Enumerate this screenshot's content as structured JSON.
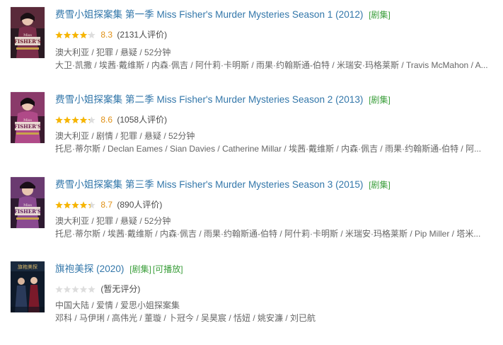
{
  "results": [
    {
      "title": "费雪小姐探案集 第一季 Miss Fisher's Murder Mysteries Season 1 (2012)",
      "tags": [
        "[剧集]"
      ],
      "score": "8.3",
      "rating_fraction": 0.83,
      "votes": "(2131人评价)",
      "meta": "澳大利亚 / 犯罪 / 悬疑 / 52分钟",
      "cast": "大卫·凯撒 / 埃茜·戴维斯 / 内森·佩吉 / 阿什莉·卡明斯 / 雨果·约翰斯通-伯特 / 米瑞安·玛格莱斯 / Travis McMahon / A..."
    },
    {
      "title": "费雪小姐探案集 第二季 Miss Fisher's Murder Mysteries Season 2 (2013)",
      "tags": [
        "[剧集]"
      ],
      "score": "8.6",
      "rating_fraction": 0.86,
      "votes": "(1058人评价)",
      "meta": "澳大利亚 / 剧情 / 犯罪 / 悬疑 / 52分钟",
      "cast": "托尼·蒂尔斯 / Declan Eames / Sian Davies / Catherine Millar / 埃茜·戴维斯 / 内森·佩吉 / 雨果·约翰斯通-伯特 / 阿..."
    },
    {
      "title": "费雪小姐探案集 第三季 Miss Fisher's Murder Mysteries Season 3 (2015)",
      "tags": [
        "[剧集]"
      ],
      "score": "8.7",
      "rating_fraction": 0.87,
      "votes": "(890人评价)",
      "meta": "澳大利亚 / 犯罪 / 悬疑 / 52分钟",
      "cast": "托尼·蒂尔斯 / 埃茜·戴维斯 / 内森·佩吉 / 雨果·约翰斯通-伯特 / 阿什莉·卡明斯 / 米瑞安·玛格莱斯 / Pip Miller / 塔米..."
    },
    {
      "title": "旗袍美探 (2020)",
      "tags": [
        "[剧集]",
        "[可播放]"
      ],
      "score": "",
      "rating_fraction": 0,
      "votes": "(暂无评分)",
      "meta": "中国大陆 / 爱情 / 爱思小姐探案集",
      "cast": "邓科 / 马伊琍 / 高伟光 / 董璇 / 卜冠今 / 吴昊宸 / 恬妞 / 姚安濂 / 刘已航"
    }
  ],
  "colors": {
    "title_link": "#3377aa",
    "tag": "#3a9e3a",
    "score": "#e09015",
    "star_filled": "#f7b500",
    "star_empty": "#dddddd",
    "meta_text": "#666666"
  },
  "poster_icons": [
    "miss-fisher-poster-icon",
    "miss-fisher-poster-icon",
    "miss-fisher-poster-icon",
    "qipao-detective-poster-icon"
  ]
}
